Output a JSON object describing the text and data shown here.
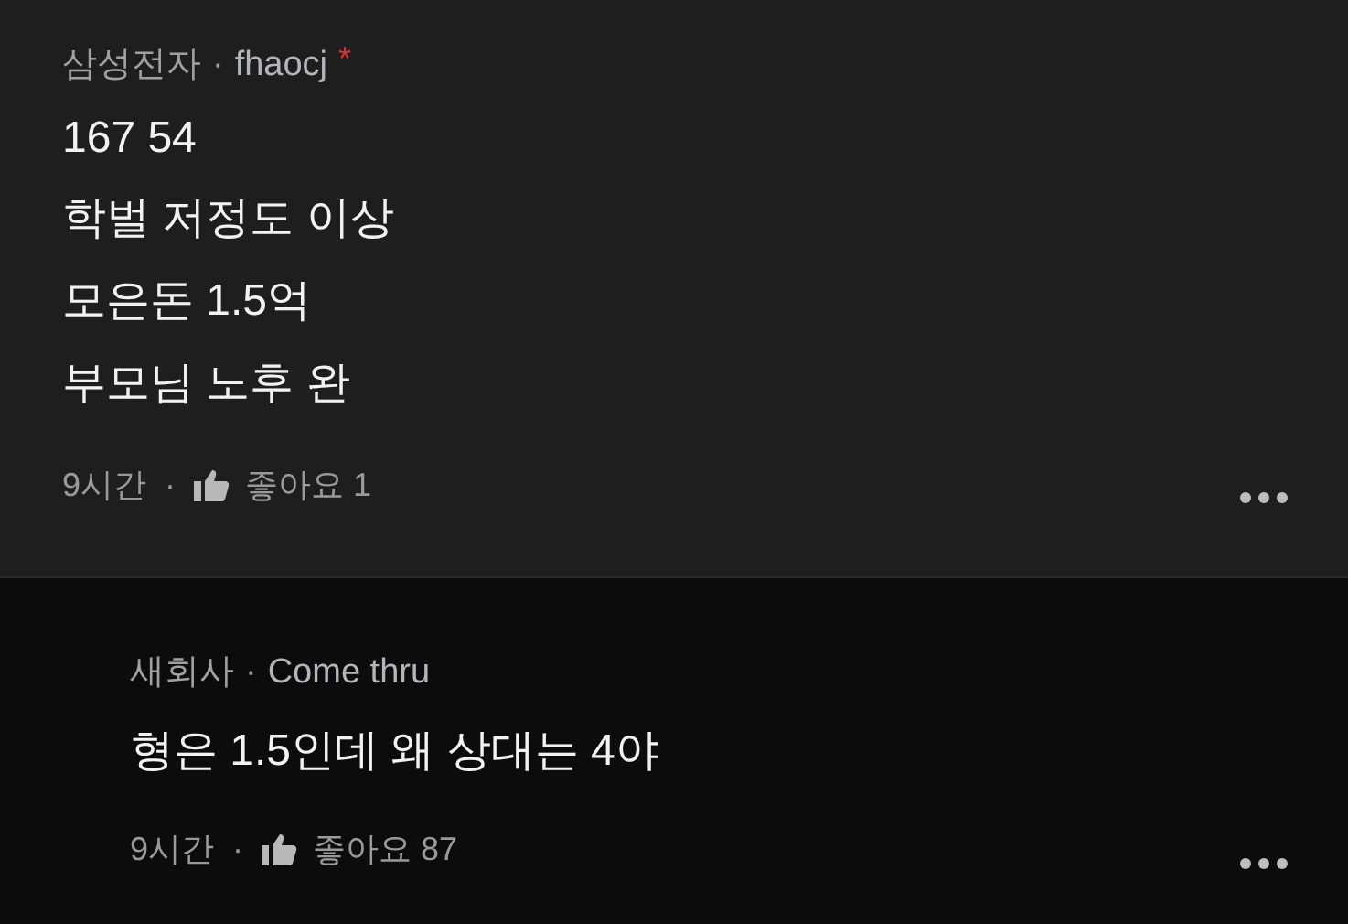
{
  "comments": [
    {
      "kind": "comment",
      "company": "삼성전자",
      "separator": "·",
      "author": "fhaocj",
      "badge": "*",
      "lines": [
        "167 54",
        "학벌 저정도 이상",
        "모은돈 1.5억",
        "부모님 노후 완"
      ],
      "time": "9시간",
      "footer_separator": "·",
      "likes": "좋아요 1"
    },
    {
      "kind": "reply",
      "company": "새회사",
      "separator": "·",
      "author": "Come thru",
      "lines": [
        "형은 1.5인데 왜 상대는 4야"
      ],
      "time": "9시간",
      "footer_separator": "·",
      "likes": "좋아요 87"
    }
  ]
}
